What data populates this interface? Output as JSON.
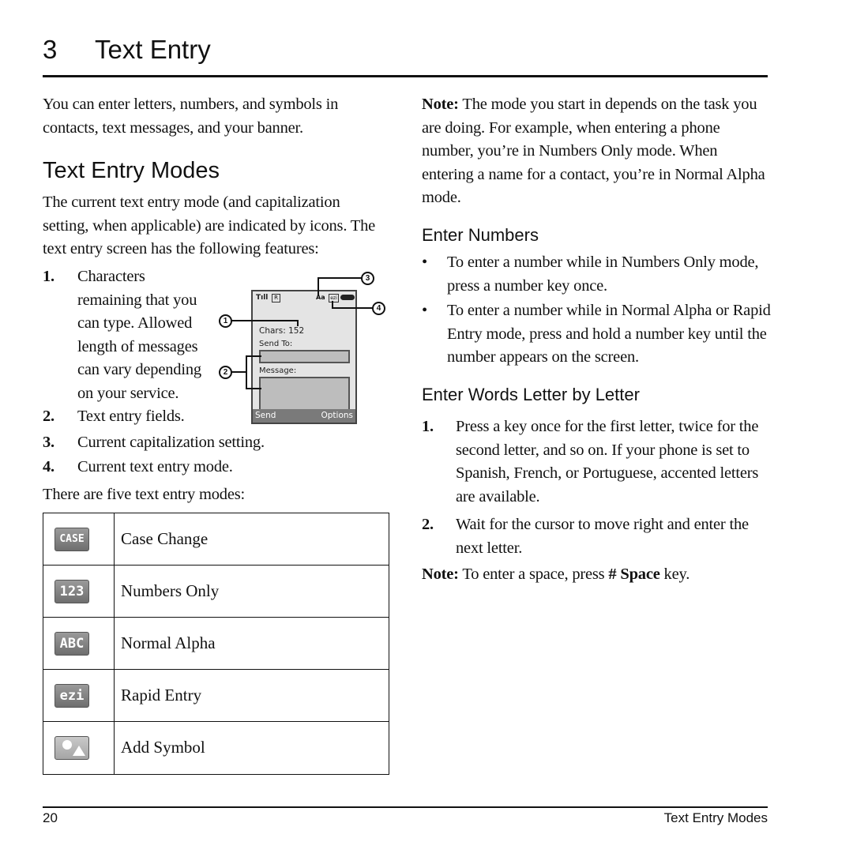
{
  "chapter": {
    "number": "3",
    "title": "Text Entry"
  },
  "intro": "You can enter letters, numbers, and symbols in contacts, text messages, and your banner.",
  "modes_section": {
    "heading": "Text Entry Modes",
    "description": "The current text entry mode (and capitalization setting, when applicable) are indicated by icons. The text entry screen has the following features:",
    "features": [
      {
        "num": "1.",
        "lines": [
          "Characters",
          "remaining that you",
          "can type. Allowed",
          "length of messages",
          "can vary depending",
          "on your service."
        ]
      },
      {
        "num": "2.",
        "lines": [
          "Text entry fields."
        ]
      },
      {
        "num": "3.",
        "lines": [
          "Current capitalization setting."
        ]
      },
      {
        "num": "4.",
        "lines": [
          "Current text entry mode."
        ]
      }
    ],
    "five_modes_intro": "There are five text entry modes:",
    "modes": [
      {
        "icon": "case-change-icon",
        "icon_text": "CASE",
        "label": "Case Change"
      },
      {
        "icon": "numbers-only-icon",
        "icon_text": "123",
        "label": "Numbers Only"
      },
      {
        "icon": "normal-alpha-icon",
        "icon_text": "ABC",
        "label": "Normal Alpha"
      },
      {
        "icon": "rapid-entry-icon",
        "icon_text": "ezi",
        "label": "Rapid Entry"
      },
      {
        "icon": "add-symbol-icon",
        "icon_text": "",
        "label": "Add Symbol"
      }
    ]
  },
  "phone_screen": {
    "signal": "Tıll",
    "roaming": "R",
    "case_indicator": "Aa",
    "mode_indicator": "ezi",
    "chars_label": "Chars: 152",
    "send_to_label": "Send To:",
    "message_label": "Message:",
    "softkey_left": "Send",
    "softkey_right": "Options",
    "callouts": [
      "1",
      "2",
      "3",
      "4"
    ]
  },
  "right_column": {
    "note1_label": "Note:",
    "note1_text": " The mode you start in depends on the task you are doing. For example, when entering a phone number, you’re in Numbers Only mode. When entering a name for a contact, you’re in Normal Alpha mode.",
    "enter_numbers_heading": "Enter Numbers",
    "enter_numbers_bullets": [
      "To enter a number while in Numbers Only mode, press a number key once.",
      "To enter a number while in Normal Alpha or Rapid Entry mode, press and hold a number key until the number appears on the screen."
    ],
    "enter_words_heading": "Enter Words Letter by Letter",
    "enter_words_steps": [
      {
        "num": "1.",
        "text": "Press a key once for the first letter, twice for the second letter, and so on. If your phone is set to Spanish, French, or Portuguese, accented letters are available."
      },
      {
        "num": "2.",
        "text": "Wait for the cursor to move right and enter the next letter."
      }
    ],
    "note2_label": "Note:",
    "note2_pre": " To enter a space, press ",
    "note2_key": "# Space",
    "note2_post": " key."
  },
  "footer": {
    "page_number": "20",
    "section_title": "Text Entry Modes"
  }
}
